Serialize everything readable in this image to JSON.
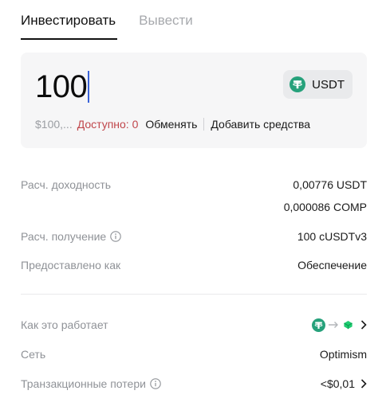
{
  "tabs": {
    "invest": "Инвестировать",
    "withdraw": "Вывести"
  },
  "input": {
    "amount": "100",
    "usd_value": "$100,...",
    "available": "Доступно: 0",
    "swap": "Обменять",
    "add_funds": "Добавить средства"
  },
  "token": {
    "symbol": "USDT",
    "icon": "tether-icon"
  },
  "details": {
    "yield_label": "Расч. доходность",
    "yield_value_1": "0,00776 USDT",
    "yield_value_2": "0,000086 COMP",
    "receive_label": "Расч. получение",
    "receive_value": "100 cUSDTv3",
    "provided_label": "Предоставлено как",
    "provided_value": "Обеспечение"
  },
  "info": {
    "how_label": "Как это работает",
    "network_label": "Сеть",
    "network_value": "Optimism",
    "fee_label": "Транзакционные потери",
    "fee_value": "<$0,01"
  },
  "colors": {
    "accent_green": "#26a17b",
    "error_red": "#c0464b",
    "compound_green": "#1fce72",
    "caret_blue": "#3a63d8"
  }
}
